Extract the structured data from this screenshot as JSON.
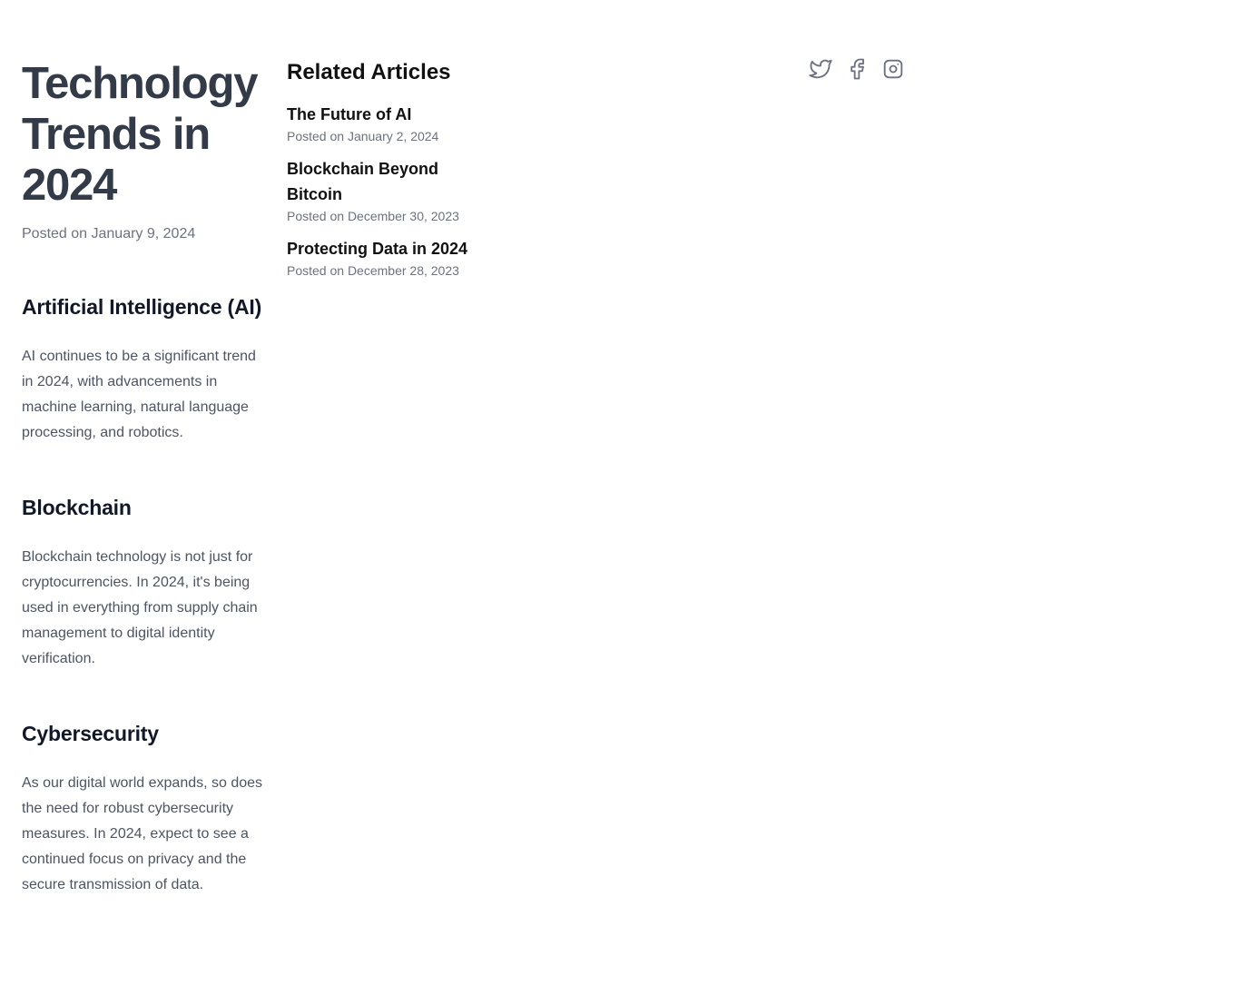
{
  "article": {
    "title": "Technology Trends in 2024",
    "date": "Posted on January 9, 2024",
    "sections": [
      {
        "heading": "Artificial Intelligence (AI)",
        "body": "AI continues to be a significant trend in 2024, with advancements in machine learning, natural language processing, and robotics."
      },
      {
        "heading": "Blockchain",
        "body": "Blockchain technology is not just for cryptocurrencies. In 2024, it's being used in everything from supply chain management to digital identity verification."
      },
      {
        "heading": "Cybersecurity",
        "body": "As our digital world expands, so does the need for robust cybersecurity measures. In 2024, expect to see a continued focus on privacy and the secure transmission of data."
      }
    ]
  },
  "related": {
    "title": "Related Articles",
    "items": [
      {
        "title": "The Future of AI",
        "date": "Posted on January 2, 2024"
      },
      {
        "title": "Blockchain Beyond Bitcoin",
        "date": "Posted on December 30, 2023"
      },
      {
        "title": "Protecting Data in 2024",
        "date": "Posted on December 28, 2023"
      }
    ]
  },
  "social": {
    "icon_color": "#6b7280",
    "icons": [
      "twitter-icon",
      "facebook-icon",
      "instagram-icon"
    ]
  }
}
